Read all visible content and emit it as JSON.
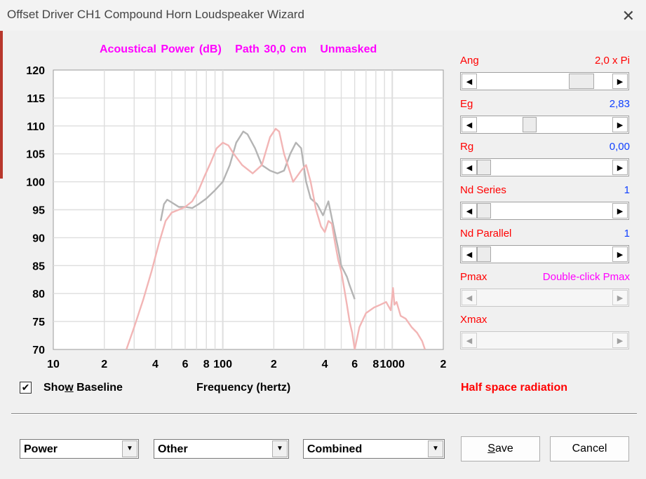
{
  "window": {
    "title": "Offset Driver CH1 Compound Horn Loudspeaker Wizard",
    "close_glyph": "✕"
  },
  "chart_header": {
    "quantity": "Acoustical Power (dB)",
    "path": "Path 30,0 cm",
    "mask": "Unmasked"
  },
  "chart_data": {
    "type": "line",
    "title": "Acoustical Power (dB)   Path 30,0 cm   Unmasked",
    "xlabel": "Frequency (hertz)",
    "ylabel": "",
    "xscale": "log",
    "xlim": [
      10,
      2000
    ],
    "ylim": [
      70,
      120
    ],
    "ytick_labels": [
      "120",
      "115",
      "110",
      "105",
      "100",
      "95",
      "90",
      "85",
      "80",
      "75",
      "70"
    ],
    "xtick_labels": [
      {
        "f": 10,
        "label": "10"
      },
      {
        "f": 20,
        "label": "2"
      },
      {
        "f": 40,
        "label": "4"
      },
      {
        "f": 60,
        "label": "6"
      },
      {
        "f": 80,
        "label": "8"
      },
      {
        "f": 100,
        "label": "100"
      },
      {
        "f": 200,
        "label": "2"
      },
      {
        "f": 400,
        "label": "4"
      },
      {
        "f": 600,
        "label": "6"
      },
      {
        "f": 800,
        "label": "8"
      },
      {
        "f": 1000,
        "label": "1000"
      },
      {
        "f": 2000,
        "label": "2"
      }
    ],
    "grid": true,
    "series": [
      {
        "color": "#b4b4b4",
        "x": [
          43,
          45,
          47,
          50,
          55,
          60,
          66,
          72,
          80,
          90,
          100,
          110,
          120,
          132,
          140,
          155,
          170,
          190,
          210,
          230,
          250,
          270,
          290,
          310,
          330,
          360,
          390,
          420,
          450,
          480,
          500,
          520,
          540,
          560,
          600
        ],
        "y": [
          93,
          96,
          96.8,
          96.3,
          95.5,
          95.5,
          95.3,
          96,
          97,
          98.5,
          100,
          103,
          107,
          109,
          108.5,
          106,
          103,
          102,
          101.5,
          102,
          105,
          107,
          106,
          100,
          97,
          96,
          94,
          96.5,
          92,
          88,
          85,
          84,
          83,
          81.5,
          79
        ]
      },
      {
        "color": "#f2b5b5",
        "x": [
          27,
          30,
          34,
          38,
          42,
          46,
          50,
          55,
          60,
          66,
          72,
          78,
          85,
          92,
          100,
          108,
          116,
          130,
          150,
          170,
          190,
          205,
          215,
          230,
          260,
          290,
          310,
          330,
          355,
          380,
          400,
          420,
          440,
          460,
          480,
          500,
          520,
          540,
          560,
          580,
          600,
          640,
          700,
          780,
          850,
          920,
          980,
          1010,
          1030,
          1060,
          1120,
          1200,
          1300,
          1400,
          1500,
          1560
        ],
        "y": [
          70,
          74,
          79,
          84,
          89,
          93,
          94.5,
          95,
          95.5,
          96.5,
          98.5,
          101,
          103.5,
          106,
          107,
          106.5,
          105,
          103,
          101.5,
          103,
          108,
          109.5,
          109,
          105,
          100,
          102,
          103,
          100,
          95,
          92,
          91,
          93,
          92.5,
          89,
          86,
          84,
          81,
          78,
          75,
          73,
          70,
          74,
          76.5,
          77.5,
          78,
          78.5,
          77,
          81,
          78,
          78.5,
          76,
          75.5,
          74,
          73,
          71.5,
          70
        ]
      }
    ]
  },
  "controls": [
    {
      "label": "Ang",
      "value": "2,0 x Pi",
      "value_color": "#ff0000",
      "level": 0.75,
      "enabled": true
    },
    {
      "label": "Eg",
      "value": "2,83",
      "value_color": "#1040ff",
      "level": 0.37,
      "enabled": true
    },
    {
      "label": "Rg",
      "value": "0,00",
      "value_color": "#1040ff",
      "level": 0.0,
      "enabled": true
    },
    {
      "label": "Nd  Series",
      "value": "1",
      "value_color": "#1040ff",
      "level": 0.0,
      "enabled": true
    },
    {
      "label": "Nd  Parallel",
      "value": "1",
      "value_color": "#1040ff",
      "level": 0.0,
      "enabled": true
    },
    {
      "label": "Pmax",
      "value": "Double-click Pmax",
      "value_color": "#ff00ff",
      "level": null,
      "enabled": false
    },
    {
      "label": "Xmax",
      "value": "",
      "value_color": "#ff00ff",
      "level": null,
      "enabled": false
    }
  ],
  "baseline": {
    "checked": true,
    "check_glyph": "✔",
    "label_pre": "Sho",
    "label_u": "w",
    "label_post": " Baseline"
  },
  "radiation_text": "Half space radiation",
  "combos": [
    {
      "value": "Power"
    },
    {
      "value": "Other"
    },
    {
      "value": "Combined"
    }
  ],
  "combo_arrow": "▼",
  "buttons": {
    "save_u": "S",
    "save_rest": "ave",
    "cancel": "Cancel"
  },
  "arrows": {
    "left": "◀",
    "right": "▶"
  }
}
